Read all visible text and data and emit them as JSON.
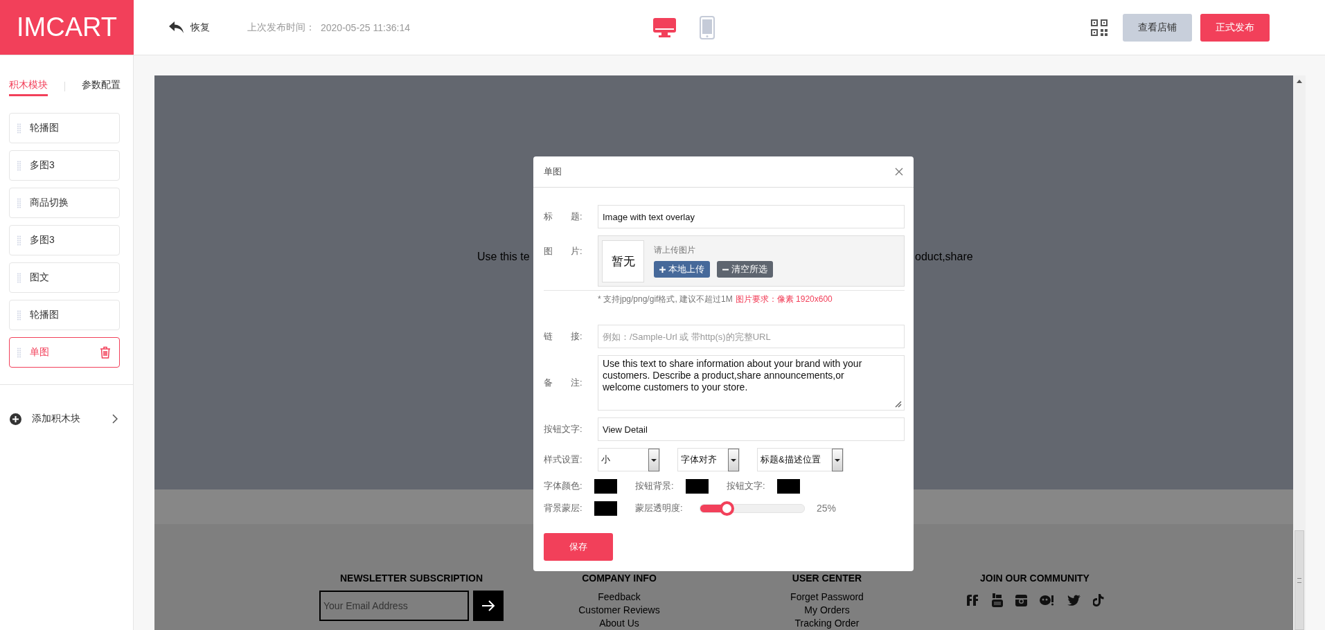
{
  "header": {
    "logo": "IMCART",
    "undo": "恢复",
    "publish_label": "上次发布时间：",
    "publish_time": "2020-05-25 11:36:14",
    "devices": [
      {
        "kind": "desktop",
        "selected": true
      },
      {
        "kind": "mobile",
        "selected": false
      }
    ],
    "view_store": "查看店铺",
    "publish": "正式发布"
  },
  "sidebar": {
    "tabs": [
      {
        "label": "积木模块",
        "selected": true
      },
      {
        "label": "参数配置",
        "selected": false
      }
    ],
    "modules": [
      {
        "label": "轮播图",
        "selected": false
      },
      {
        "label": "多图3",
        "selected": false
      },
      {
        "label": "商品切换",
        "selected": false
      },
      {
        "label": "多图3",
        "selected": false
      },
      {
        "label": "图文",
        "selected": false
      },
      {
        "label": "轮播图",
        "selected": false
      },
      {
        "label": "单图",
        "selected": true
      }
    ],
    "add_block": "添加积木块"
  },
  "preview": {
    "hero_text_left": "Use this te",
    "hero_text_right": "oduct,share",
    "footer": [
      {
        "kind": "newsletter",
        "heading": "NEWSLETTER SUBSCRIPTION",
        "placeholder": "Your Email Address"
      },
      {
        "kind": "links",
        "heading": "COMPANY INFO",
        "links": [
          "Feedback",
          "Customer Reviews",
          "About Us"
        ]
      },
      {
        "kind": "links",
        "heading": "USER CENTER",
        "links": [
          "Forget Password",
          "My Orders",
          "Tracking Order"
        ]
      },
      {
        "kind": "social",
        "heading": "JOIN OUR COMMUNITY"
      }
    ]
  },
  "dialog": {
    "title": "单图",
    "title_field": {
      "label": "标　　题:",
      "value": "Image with text overlay"
    },
    "image": {
      "label": "图　　片:",
      "thumb": "暂无",
      "prompt": "请上传图片",
      "upload": "本地上传",
      "clear": "清空所选",
      "hint": "* 支持jpg/png/gif格式, 建议不超过1M",
      "requirement": "图片要求：像素 1920x600"
    },
    "link_field": {
      "label": "链　　接:",
      "placeholder": "例如：/Sample-Url 或 带http(s)的完整URL"
    },
    "note_field": {
      "label": "备　　注:",
      "value": "Use this text to share information about your brand with your customers. Describe a product,share announcements,or welcome customers to your store."
    },
    "button_text_field": {
      "label": "按钮文字:",
      "value": "View Detail"
    },
    "style": {
      "label": "样式设置:",
      "selects": [
        "小",
        "字体对齐",
        "标题&描述位置"
      ]
    },
    "colors": [
      {
        "label": "字体颜色:",
        "color": "#000000"
      },
      {
        "label": "按钮背景:",
        "color": "#000000"
      },
      {
        "label": "按钮文字:",
        "color": "#000000"
      },
      {
        "label": "背景蒙层:",
        "color": "#000000"
      }
    ],
    "opacity": {
      "label": "蒙层透明度:",
      "level": 0.25,
      "reading": "25%"
    },
    "save": "保存"
  }
}
